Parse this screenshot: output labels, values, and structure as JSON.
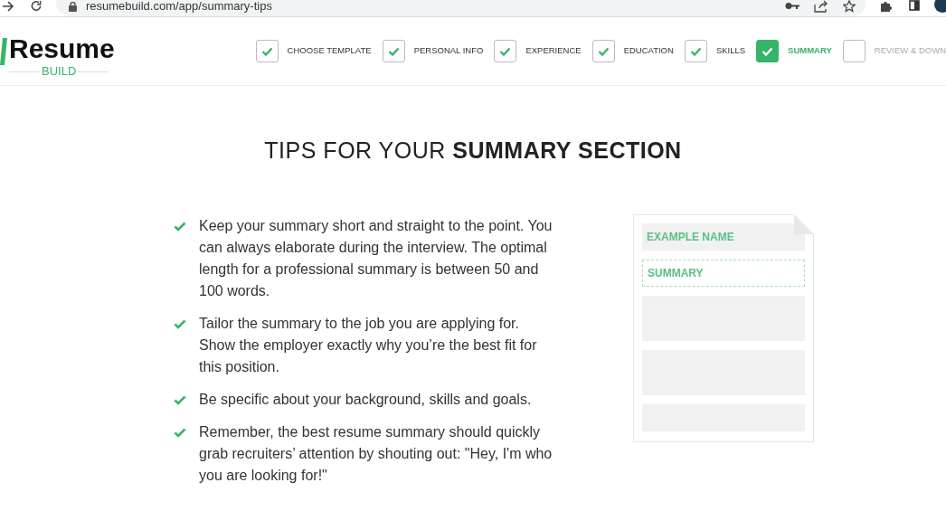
{
  "browser": {
    "url": "resumebuild.com/app/summary-tips"
  },
  "logo": {
    "title": "Resume",
    "subtitle": "BUILD"
  },
  "steps": [
    {
      "label": "CHOOSE TEMPLATE",
      "checked": true,
      "selected": false
    },
    {
      "label": "PERSONAL INFO",
      "checked": true,
      "selected": false
    },
    {
      "label": "EXPERIENCE",
      "checked": true,
      "selected": false
    },
    {
      "label": "EDUCATION",
      "checked": true,
      "selected": false
    },
    {
      "label": "SKILLS",
      "checked": true,
      "selected": false
    },
    {
      "label": "SUMMARY",
      "checked": true,
      "selected": true
    },
    {
      "label": "REVIEW & DOWN",
      "checked": false,
      "selected": false
    }
  ],
  "heading": "TIPS FOR YOUR **SUMMARY SECTION**",
  "tips": [
    "Keep your summary short and straight to the point. You can always elaborate during the interview. The optimal length for a professional summary is between 50 and 100 words.",
    "Tailor the summary to the job you are applying for. Show the employer exactly why you’re the best fit for this position.",
    "Be specific about your background, skills and goals.",
    "Remember, the best resume summary should quickly grab recruiters’ attention by shouting out: \"Hey, I'm who you are looking for!\""
  ],
  "preview": {
    "name_label": "EXAMPLE NAME",
    "summary_label": "SUMMARY"
  }
}
